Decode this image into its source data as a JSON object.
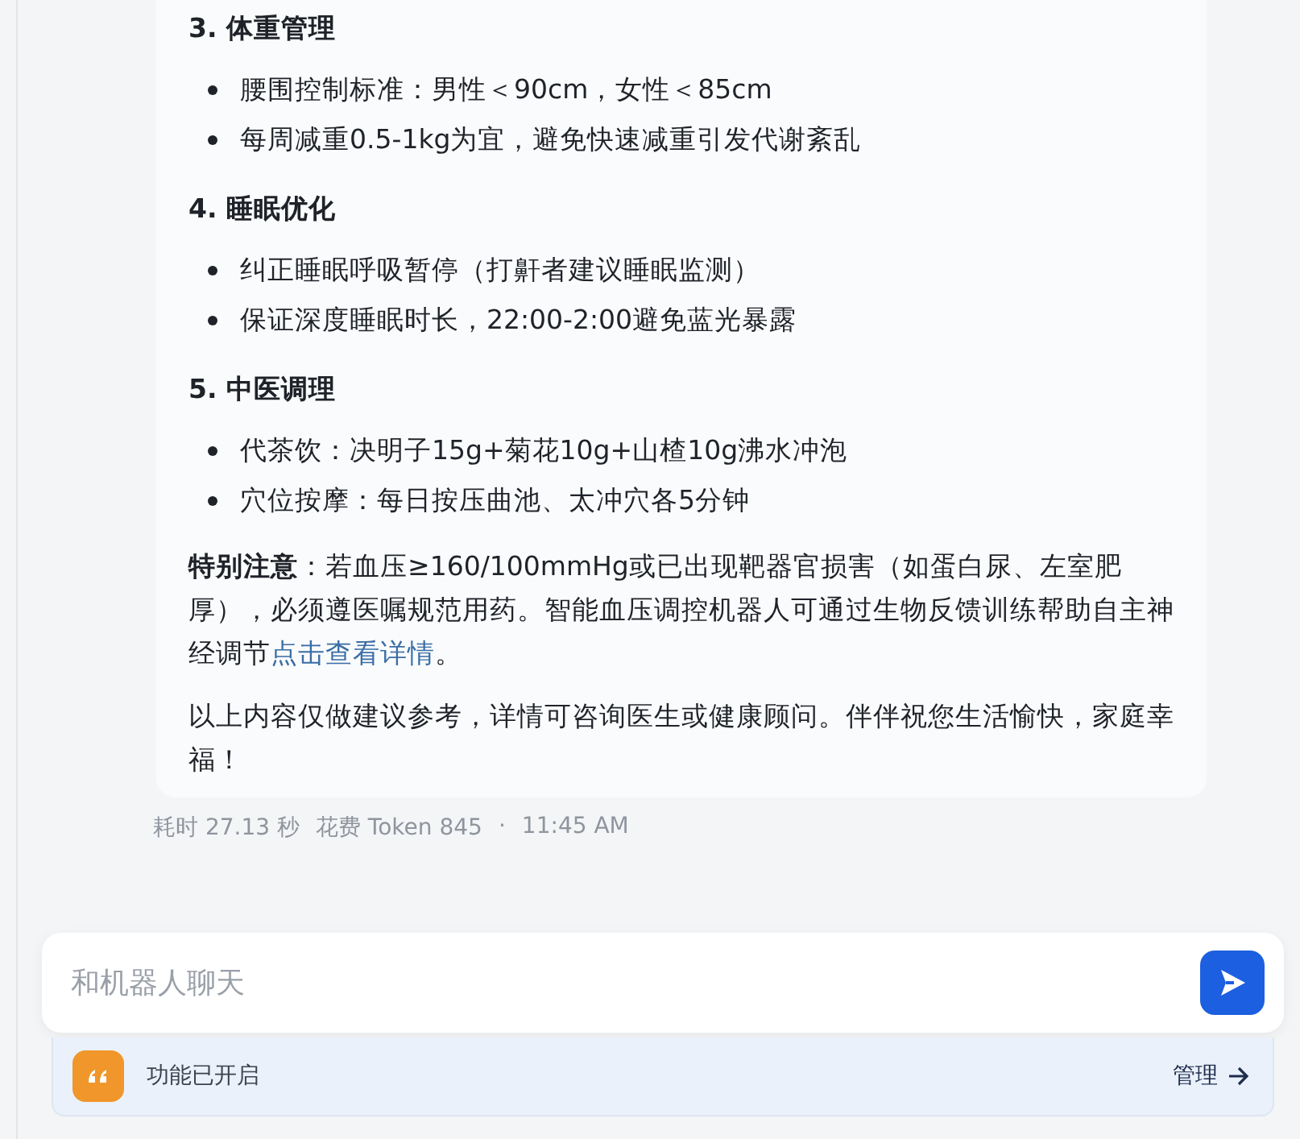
{
  "sections": [
    {
      "heading": "3. 体重管理",
      "items": [
        "腰围控制标准：男性＜90cm，女性＜85cm",
        "每周减重0.5-1kg为宜，避免快速减重引发代谢紊乱"
      ]
    },
    {
      "heading": "4. 睡眠优化",
      "items": [
        "纠正睡眠呼吸暂停（打鼾者建议睡眠监测）",
        "保证深度睡眠时长，22:00-2:00避免蓝光暴露"
      ]
    },
    {
      "heading": "5. 中医调理",
      "items": [
        "代茶饮：决明子15g+菊花10g+山楂10g沸水冲泡",
        "穴位按摩：每日按压曲池、太冲穴各5分钟"
      ]
    }
  ],
  "note": {
    "text": "**特别注意**：若血压≥160/100mmHg或已出现靶器官损害（如蛋白尿、左室肥厚），必须遵医嘱规范用药。智能血压调控机器人可通过生物反馈训练帮助自主神经调节",
    "link": "点击查看详情",
    "tail": "。"
  },
  "closing": "以上内容仅做建议参考，详情可咨询医生或健康顾问。伴伴祝您生活愉快，家庭幸福！",
  "meta": {
    "elapsed": "耗时 27.13 秒",
    "cost": "花费 Token 845",
    "separator": "·",
    "time": "11:45 AM"
  },
  "composer": {
    "placeholder": "和机器人聊天"
  },
  "feature_bar": {
    "label": "功能已开启",
    "action": "管理"
  }
}
